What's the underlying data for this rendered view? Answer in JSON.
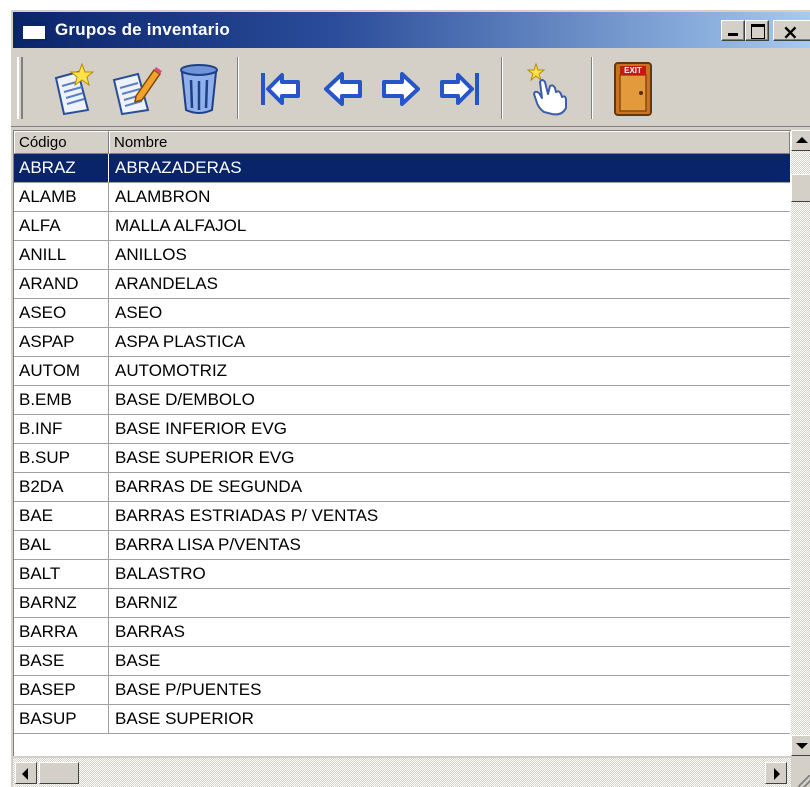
{
  "window": {
    "title": "Grupos de inventario",
    "close_glyph": "×",
    "title_bar_color": "#0a246a"
  },
  "toolbar": {
    "buttons": [
      {
        "name": "new-record-button",
        "icon": "new-document-icon"
      },
      {
        "name": "edit-record-button",
        "icon": "edit-document-icon"
      },
      {
        "name": "delete-record-button",
        "icon": "trash-can-icon"
      },
      {
        "name": "first-record-button",
        "icon": "first-arrow-icon"
      },
      {
        "name": "previous-record-button",
        "icon": "left-arrow-icon"
      },
      {
        "name": "next-record-button",
        "icon": "right-arrow-icon"
      },
      {
        "name": "last-record-button",
        "icon": "last-arrow-icon"
      },
      {
        "name": "select-button",
        "icon": "pointing-hand-icon"
      },
      {
        "name": "exit-button",
        "icon": "exit-door-icon",
        "label": "EXIT"
      }
    ]
  },
  "grid": {
    "columns": [
      "Código",
      "Nombre"
    ],
    "selected_index": 0,
    "selection_color": "#0a246a",
    "rows": [
      [
        "ABRAZ",
        "ABRAZADERAS"
      ],
      [
        "ALAMB",
        "ALAMBRON"
      ],
      [
        "ALFA",
        "MALLA ALFAJOL"
      ],
      [
        "ANILL",
        "ANILLOS"
      ],
      [
        "ARAND",
        "ARANDELAS"
      ],
      [
        "ASEO",
        "ASEO"
      ],
      [
        "ASPAP",
        "ASPA PLASTICA"
      ],
      [
        "AUTOM",
        "AUTOMOTRIZ"
      ],
      [
        "B.EMB",
        "BASE D/EMBOLO"
      ],
      [
        "B.INF",
        "BASE INFERIOR EVG"
      ],
      [
        "B.SUP",
        "BASE SUPERIOR EVG"
      ],
      [
        "B2DA",
        "BARRAS DE SEGUNDA"
      ],
      [
        "BAE",
        "BARRAS ESTRIADAS P/ VENTAS"
      ],
      [
        "BAL",
        "BARRA LISA P/VENTAS"
      ],
      [
        "BALT",
        "BALASTRO"
      ],
      [
        "BARNZ",
        "BARNIZ"
      ],
      [
        "BARRA",
        "BARRAS"
      ],
      [
        "BASE",
        "BASE"
      ],
      [
        "BASEP",
        "BASE P/PUENTES"
      ],
      [
        "BASUP",
        "BASE SUPERIOR"
      ]
    ]
  }
}
